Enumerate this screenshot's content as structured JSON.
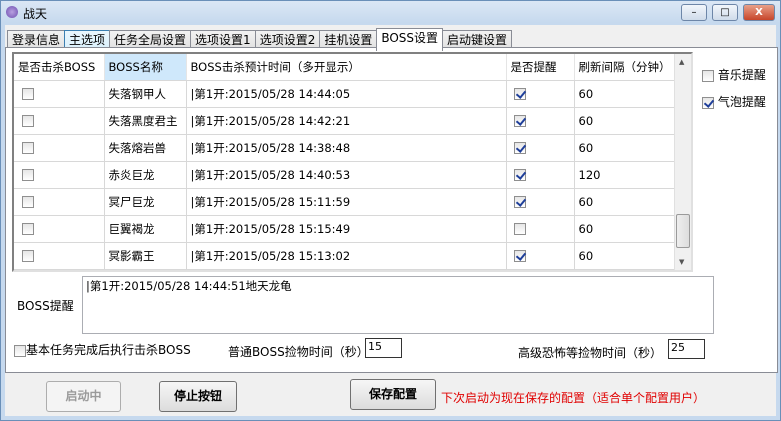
{
  "window": {
    "title": "战天",
    "min": "–",
    "max": "□",
    "close": "X"
  },
  "tabs": [
    "登录信息",
    "主选项",
    "任务全局设置",
    "选项设置1",
    "选项设置2",
    "挂机设置",
    "BOSS设置",
    "启动键设置"
  ],
  "grid": {
    "headers": [
      "是否击杀BOSS",
      "BOSS名称",
      "BOSS击杀预计时间（多开显示）",
      "是否提醒",
      "刷新间隔（分钟）"
    ],
    "rows": [
      {
        "kill": false,
        "name": "失落钢甲人",
        "time": "|第1开:2015/05/28 14:44:05",
        "remind": true,
        "interval": "60"
      },
      {
        "kill": false,
        "name": "失落黑度君主",
        "time": "|第1开:2015/05/28 14:42:21",
        "remind": true,
        "interval": "60"
      },
      {
        "kill": false,
        "name": "失落熔岩兽",
        "time": "|第1开:2015/05/28 14:38:48",
        "remind": true,
        "interval": "60"
      },
      {
        "kill": false,
        "name": "赤炎巨龙",
        "time": "|第1开:2015/05/28 14:40:53",
        "remind": true,
        "interval": "120"
      },
      {
        "kill": false,
        "name": "冥尸巨龙",
        "time": "|第1开:2015/05/28 15:11:59",
        "remind": true,
        "interval": "60"
      },
      {
        "kill": false,
        "name": "巨翼褐龙",
        "time": "|第1开:2015/05/28 15:15:49",
        "remind": false,
        "interval": "60"
      },
      {
        "kill": false,
        "name": "冥影霸王",
        "time": "|第1开:2015/05/28 15:13:02",
        "remind": true,
        "interval": "60"
      }
    ]
  },
  "options": {
    "music": "音乐提醒",
    "music_on": false,
    "bubble": "气泡提醒",
    "bubble_on": true
  },
  "alert": {
    "label": "BOSS提醒",
    "text": "|第1开:2015/05/28 14:44:51地天龙龟"
  },
  "bottom": {
    "kill_after": "基本任务完成后执行击杀BOSS",
    "normal_label": "普通BOSS捡物时间（秒）",
    "normal_value": "15",
    "adv_label": "高级恐怖等捡物时间（秒）",
    "adv_value": "25"
  },
  "buttons": {
    "start": "启动中",
    "stop": "停止按钮",
    "save": "保存配置",
    "note": "下次启动为现在保存的配置（适合单个配置用户）"
  }
}
